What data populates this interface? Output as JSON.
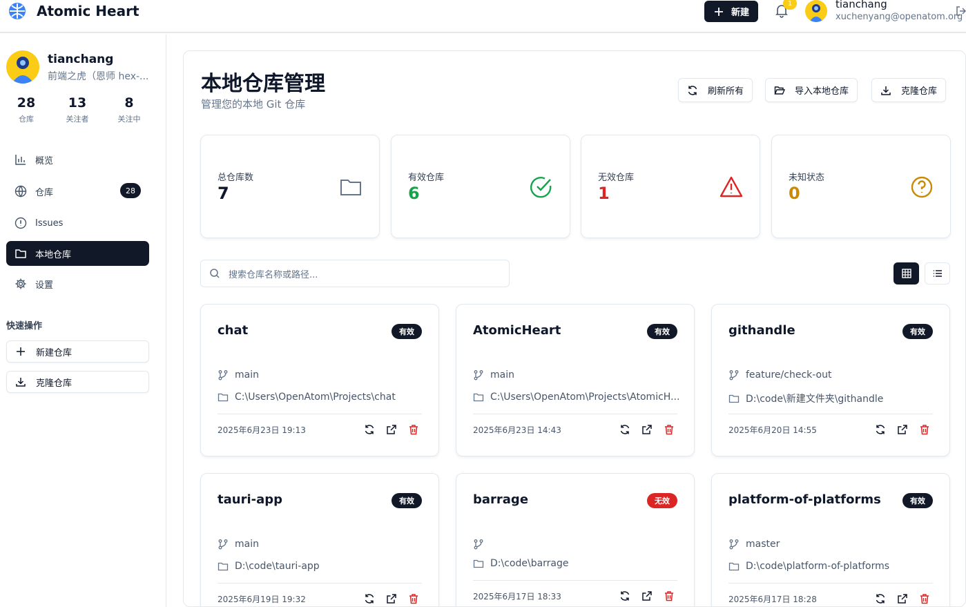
{
  "app": {
    "title": "Atomic Heart",
    "new_label": "新建",
    "notif_count": "1"
  },
  "user": {
    "name": "tianchang",
    "email": "xuchenyang@openatom.org",
    "bio": "前端之虎（恩师 hex-..."
  },
  "stats": [
    {
      "value": "28",
      "label": "仓库"
    },
    {
      "value": "13",
      "label": "关注者"
    },
    {
      "value": "8",
      "label": "关注中"
    }
  ],
  "nav": [
    {
      "label": "概览",
      "icon": "chart-icon"
    },
    {
      "label": "仓库",
      "icon": "globe-icon",
      "count": "28"
    },
    {
      "label": "Issues",
      "icon": "alert-circle-icon"
    },
    {
      "label": "本地仓库",
      "icon": "folder-icon",
      "active": true
    },
    {
      "label": "设置",
      "icon": "gear-icon"
    }
  ],
  "quick": {
    "title": "快速操作",
    "new_repo": "新建仓库",
    "clone_repo": "克隆仓库"
  },
  "page": {
    "title": "本地仓库管理",
    "subtitle": "管理您的本地 Git 仓库",
    "refresh_all": "刷新所有",
    "import_local": "导入本地仓库",
    "clone": "克隆仓库",
    "search_placeholder": "搜索仓库名称或路径..."
  },
  "summary": [
    {
      "label": "总仓库数",
      "value": "7",
      "color": "#0f172a",
      "icon": "folder-icon"
    },
    {
      "label": "有效仓库",
      "value": "6",
      "color": "#16a34a",
      "icon": "check-circle-icon"
    },
    {
      "label": "无效仓库",
      "value": "1",
      "color": "#dc2626",
      "icon": "warning-icon"
    },
    {
      "label": "未知状态",
      "value": "0",
      "color": "#ca8a04",
      "icon": "help-circle-icon"
    }
  ],
  "repos": [
    {
      "name": "chat",
      "status": "有效",
      "valid": true,
      "branch": "main",
      "path": "C:\\Users\\OpenAtom\\Projects\\chat",
      "date": "2025年6月23日 19:13"
    },
    {
      "name": "AtomicHeart",
      "status": "有效",
      "valid": true,
      "branch": "main",
      "path": "C:\\Users\\OpenAtom\\Projects\\AtomicH...",
      "date": "2025年6月23日 14:43"
    },
    {
      "name": "githandle",
      "status": "有效",
      "valid": true,
      "branch": "feature/check-out",
      "path": "D:\\code\\新建文件夹\\githandle",
      "date": "2025年6月20日 14:55"
    },
    {
      "name": "tauri-app",
      "status": "有效",
      "valid": true,
      "branch": "main",
      "path": "D:\\code\\tauri-app",
      "date": "2025年6月19日 19:32"
    },
    {
      "name": "barrage",
      "status": "无效",
      "valid": false,
      "branch": "",
      "path": "D:\\code\\barrage",
      "date": "2025年6月17日 18:33"
    },
    {
      "name": "platform-of-platforms",
      "status": "有效",
      "valid": true,
      "branch": "master",
      "path": "D:\\code\\platform-of-platforms",
      "date": "2025年6月17日 18:28"
    }
  ],
  "colors": {
    "valid_badge": "#111827",
    "invalid_badge": "#dc2626",
    "delete": "#dc2626"
  }
}
